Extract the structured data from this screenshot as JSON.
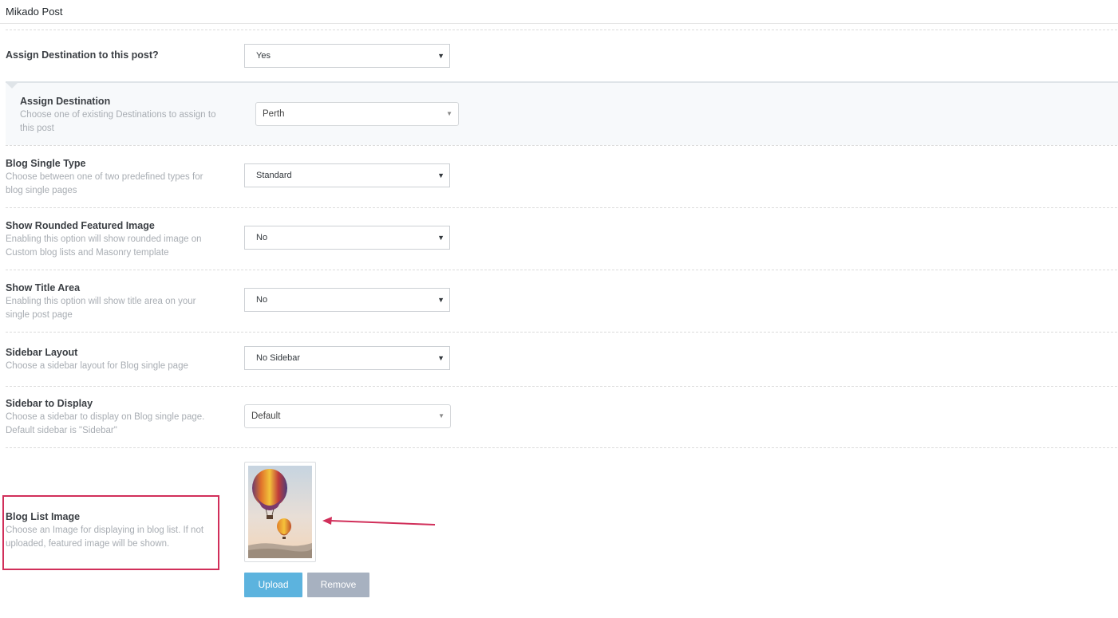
{
  "panel": {
    "title": "Mikado Post"
  },
  "assign_destination_toggle": {
    "label": "Assign Destination to this post?",
    "value": "Yes"
  },
  "assign_destination": {
    "title": "Assign Destination",
    "desc": "Choose one of existing Destinations to assign to this post",
    "value": "Perth"
  },
  "blog_single_type": {
    "title": "Blog Single Type",
    "desc": "Choose between one of two predefined types for blog single pages",
    "value": "Standard"
  },
  "rounded_featured_image": {
    "title": "Show Rounded Featured Image",
    "desc": "Enabling this option will show rounded image on Custom blog lists and Masonry template",
    "value": "No"
  },
  "title_area": {
    "title": "Show Title Area",
    "desc": "Enabling this option will show title area on your single post page",
    "value": "No"
  },
  "sidebar_layout": {
    "title": "Sidebar Layout",
    "desc": "Choose a sidebar layout for Blog single page",
    "value": "No Sidebar"
  },
  "sidebar_display": {
    "title": "Sidebar to Display",
    "desc": "Choose a sidebar to display on Blog single page. Default sidebar is \"Sidebar\"",
    "value": "Default"
  },
  "blog_list_image": {
    "title": "Blog List Image",
    "desc": "Choose an Image for displaying in blog list. If not uploaded, featured image will be shown.",
    "upload_label": "Upload",
    "remove_label": "Remove"
  },
  "icons": {
    "dropdown": "dropdown-arrow-icon",
    "annotation": "arrow-left-icon"
  },
  "colors": {
    "highlight": "#d12f5a",
    "upload_button": "#5cb3de",
    "remove_button": "#a7b1c0",
    "label_gray": "#a8adb3"
  }
}
